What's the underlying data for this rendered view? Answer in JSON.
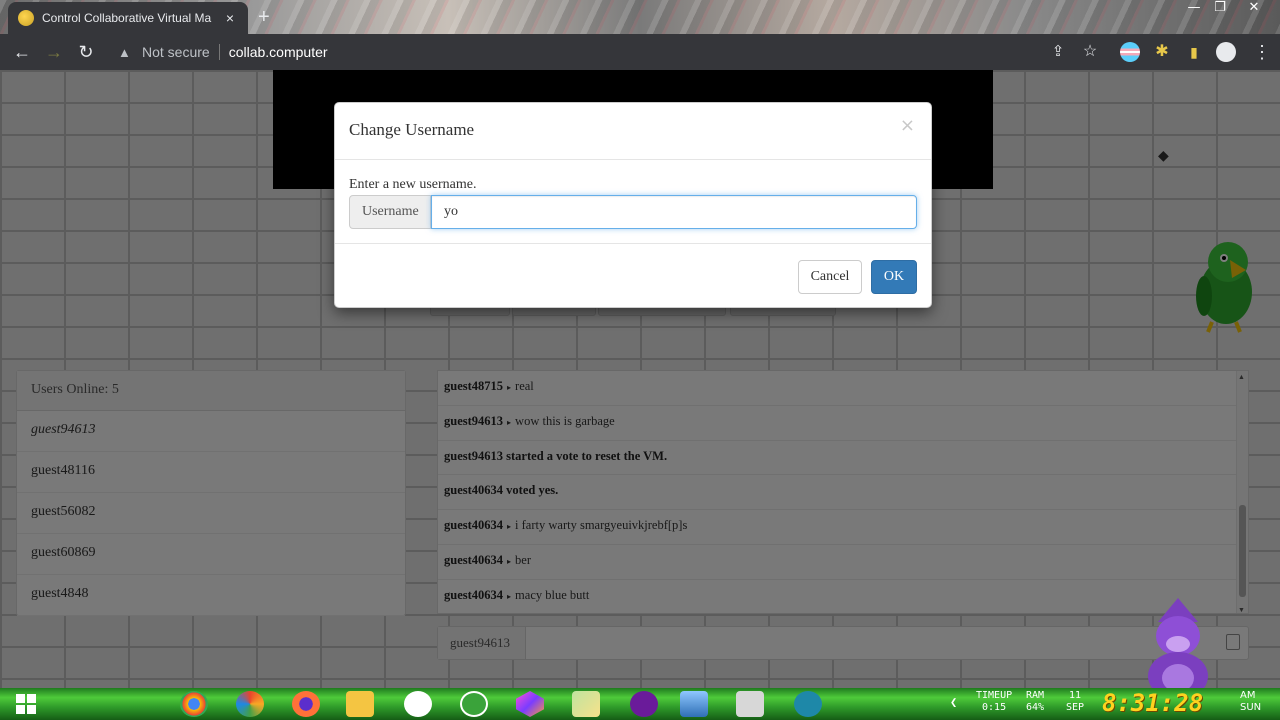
{
  "browser": {
    "tab_title": "Control Collaborative Virtual Ma",
    "tab_close": "×",
    "new_tab": "+",
    "security_label": "Not secure",
    "url": "collab.computer",
    "window_controls": [
      "—",
      "❐",
      "✕"
    ]
  },
  "page": {
    "users_panel": {
      "header": "Users Online: 5",
      "users": [
        "guest94613",
        "guest48116",
        "guest56082",
        "guest60869",
        "guest4848"
      ]
    },
    "chat": {
      "messages": [
        {
          "user": "guest48715",
          "text": "real"
        },
        {
          "user": "guest94613",
          "text": "wow this is garbage"
        },
        {
          "system": "guest94613 started a vote to reset the VM."
        },
        {
          "system": "guest40634 voted yes."
        },
        {
          "user": "guest40634",
          "text": "i farty warty smargyeuivkjrebf[p]s"
        },
        {
          "user": "guest40634",
          "text": "ber"
        },
        {
          "user": "guest40634",
          "text": "macy blue butt"
        }
      ],
      "current_username": "guest94613"
    }
  },
  "modal": {
    "title": "Change Username",
    "close": "×",
    "prompt": "Enter a new username.",
    "addon_label": "Username",
    "input_value": "yo",
    "cancel_label": "Cancel",
    "ok_label": "OK"
  },
  "taskbar": {
    "timeup_label": "TIMEUP",
    "timeup_value": "0:15",
    "ram_label": "RAM",
    "ram_value": "64%",
    "date_day": "11",
    "date_month": "SEP",
    "clock": "8:31:28",
    "ampm": "AM",
    "weekday": "SUN"
  },
  "colors": {
    "primary_button": "#337ab7",
    "chrome_dark": "#35363a",
    "clock_yellow": "#ffd21f",
    "taskbar_green": "#2f9b2a"
  }
}
